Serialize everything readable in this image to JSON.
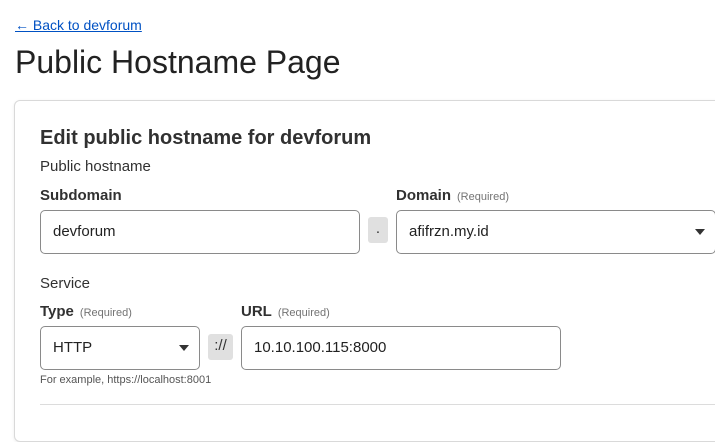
{
  "nav": {
    "back_label": "← Back to devforum"
  },
  "page": {
    "title": "Public Hostname Page"
  },
  "form": {
    "title": "Edit public hostname for devforum",
    "public_hostname_section": "Public hostname",
    "subdomain": {
      "label": "Subdomain",
      "value": "devforum"
    },
    "dot_separator": ".",
    "domain": {
      "label": "Domain",
      "required": "(Required)",
      "value": "afifrzn.my.id"
    },
    "service_section": "Service",
    "type": {
      "label": "Type",
      "required": "(Required)",
      "value": "HTTP"
    },
    "scheme_separator": "://",
    "url": {
      "label": "URL",
      "required": "(Required)",
      "value": "10.10.100.115:8000"
    },
    "hint": "For example, https://localhost:8001"
  }
}
